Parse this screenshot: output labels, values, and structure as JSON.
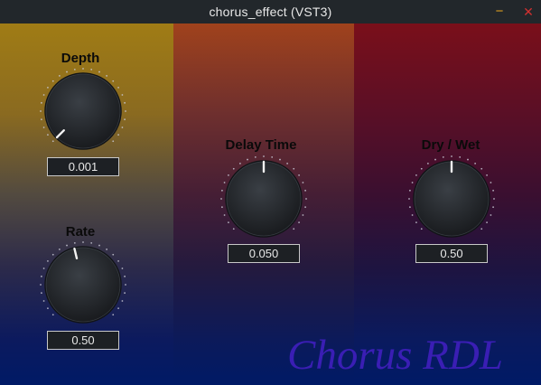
{
  "window": {
    "title": "chorus_effect (VST3)",
    "minimize_glyph": "−",
    "close_glyph": "✕",
    "minimize_color": "#e0a020",
    "close_color": "#d03030"
  },
  "knobs": [
    {
      "id": "depth",
      "label": "Depth",
      "value": "0.001",
      "normalized": 0.0
    },
    {
      "id": "rate",
      "label": "Rate",
      "value": "0.50",
      "normalized": 0.45
    },
    {
      "id": "delay",
      "label": "Delay Time",
      "value": "0.050",
      "normalized": 0.5
    },
    {
      "id": "drywet",
      "label": "Dry / Wet",
      "value": "0.50",
      "normalized": 0.5
    }
  ],
  "brand": {
    "text": "Chorus RDL",
    "color": "#3a1eb4"
  },
  "colors": {
    "left_top": "#a07c15",
    "mid_top": "#a0421c",
    "right_top": "#7a0f1a",
    "bottom": "#001a66"
  }
}
